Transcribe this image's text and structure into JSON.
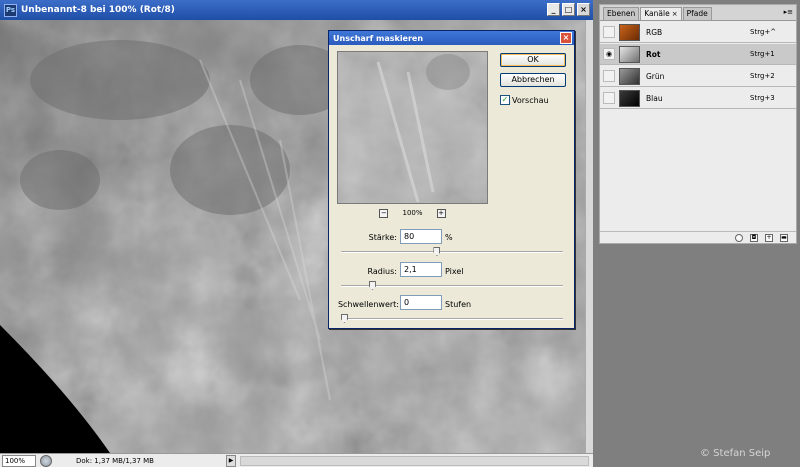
{
  "document": {
    "title": "Unbenannt-8 bei 100% (Rot/8)",
    "app_icon": "Ps",
    "icons": [
      "minimize-icon",
      "maximize-icon",
      "close-icon"
    ],
    "status": {
      "zoom": "100%",
      "doc_info": "Dok: 1,37 MB/1,37 MB",
      "arrow": "▶"
    }
  },
  "dialog": {
    "title": "Unscharf maskieren",
    "ok_label": "OK",
    "cancel_label": "Abbrechen",
    "preview_label": "Vorschau",
    "preview_checked": true,
    "zoom_minus": "−",
    "zoom_plus": "+",
    "zoom_level": "100%",
    "fields": [
      {
        "label": "Stärke:",
        "value": "80",
        "unit": "%",
        "slider_position": 0.43
      },
      {
        "label": "Radius:",
        "value": "2,1",
        "unit": "Pixel",
        "slider_position": 0.13
      },
      {
        "label": "Schwellenwert:",
        "value": "0",
        "unit": "Stufen",
        "slider_position": 0.0
      }
    ]
  },
  "panel": {
    "tabs": [
      {
        "label": "Ebenen",
        "active": false
      },
      {
        "label": "Kanäle",
        "active": true,
        "close": "×"
      },
      {
        "label": "Pfade",
        "active": false
      }
    ],
    "menu": "▸≡",
    "channels": [
      {
        "name": "RGB",
        "shortcut": "Strg+^",
        "active": false,
        "visible": false
      },
      {
        "name": "Rot",
        "shortcut": "Strg+1",
        "active": true,
        "visible": true
      },
      {
        "name": "Grün",
        "shortcut": "Strg+2",
        "active": false,
        "visible": false
      },
      {
        "name": "Blau",
        "shortcut": "Strg+3",
        "active": false,
        "visible": false
      }
    ],
    "eye_glyph": "◉",
    "footer_icons": [
      "channel-selection-icon",
      "save-mask-icon",
      "new-channel-icon",
      "trash-icon"
    ]
  },
  "copyright": "© Stefan Seip"
}
